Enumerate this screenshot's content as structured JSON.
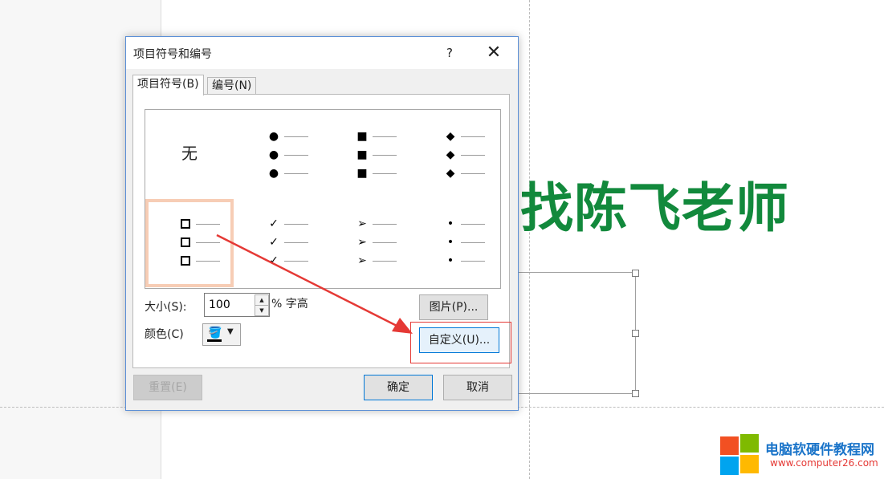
{
  "slide": {
    "title_text": "找陈飞老师"
  },
  "dialog": {
    "title": "项目符号和编号",
    "help_label": "?",
    "close_label": "✕",
    "tabs": [
      {
        "label": "项目符号(B)"
      },
      {
        "label": "编号(N)"
      }
    ],
    "gallery": {
      "none_label": "无",
      "bullets": [
        {
          "name": "filled-circle",
          "glyph": "●"
        },
        {
          "name": "filled-square",
          "glyph": "■"
        },
        {
          "name": "filled-diamond",
          "glyph": "◆"
        },
        {
          "name": "hollow-square",
          "glyph": "□",
          "selected": true
        },
        {
          "name": "checkmark",
          "glyph": "✓"
        },
        {
          "name": "arrowhead",
          "glyph": "➢"
        },
        {
          "name": "small-dot",
          "glyph": "•"
        }
      ]
    },
    "size": {
      "label": "大小(S):",
      "value": "100",
      "unit": "% 字高"
    },
    "color": {
      "label": "颜色(C)",
      "value": "#000000"
    },
    "buttons": {
      "picture": "图片(P)...",
      "custom": "自定义(U)...",
      "reset": "重置(E)",
      "ok": "确定",
      "cancel": "取消"
    }
  },
  "watermark": {
    "site_name": "电脑软硬件教程网",
    "url": "www.computer26.com"
  },
  "colors": {
    "title_green": "#12893c",
    "selection": "#f7cdb5",
    "annotation_red": "#e53935",
    "accent_blue": "#0078d7"
  }
}
